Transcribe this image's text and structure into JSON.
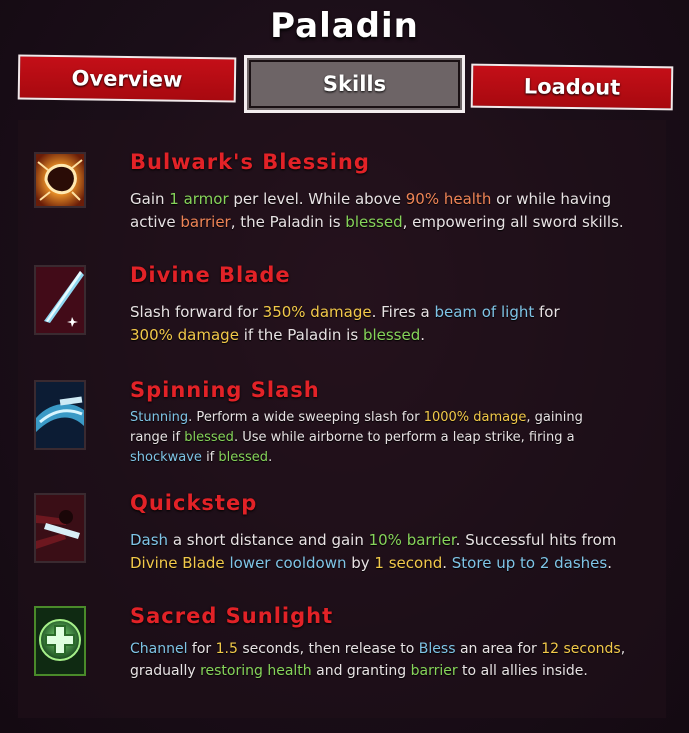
{
  "title": "Paladin",
  "tabs": {
    "overview": "Overview",
    "skills": "Skills",
    "loadout": "Loadout"
  },
  "colors": {
    "tab_red": "#c40f18",
    "skill_name": "#e22227",
    "green": "#86d35a",
    "orange": "#ee8456",
    "yellow": "#f2c94a",
    "blue": "#7fc4e6"
  },
  "skills": [
    {
      "name": "Bulwark's Blessing",
      "icon": "shield-crack-icon",
      "line1": [
        {
          "t": "Gain ",
          "c": ""
        },
        {
          "t": "1 armor",
          "c": "g"
        },
        {
          "t": " per level. While above ",
          "c": ""
        },
        {
          "t": "90% health",
          "c": "o"
        },
        {
          "t": " or while having",
          "c": ""
        }
      ],
      "line2": [
        {
          "t": "active ",
          "c": ""
        },
        {
          "t": "barrier",
          "c": "o"
        },
        {
          "t": ", the Paladin is ",
          "c": ""
        },
        {
          "t": "blessed",
          "c": "g"
        },
        {
          "t": ", empowering all sword skills.",
          "c": ""
        }
      ]
    },
    {
      "name": "Divine Blade",
      "icon": "sword-icon",
      "line1": [
        {
          "t": "Slash forward for ",
          "c": ""
        },
        {
          "t": "350% damage",
          "c": "y"
        },
        {
          "t": ". Fires a ",
          "c": ""
        },
        {
          "t": "beam of light",
          "c": "b"
        },
        {
          "t": " for",
          "c": ""
        }
      ],
      "line2": [
        {
          "t": "300% damage",
          "c": "y"
        },
        {
          "t": " if the Paladin is ",
          "c": ""
        },
        {
          "t": "blessed",
          "c": "g"
        },
        {
          "t": ".",
          "c": ""
        }
      ]
    },
    {
      "name": "Spinning Slash",
      "icon": "spin-slash-icon",
      "line1": [
        {
          "t": "Stunning",
          "c": "b"
        },
        {
          "t": ". Perform a wide sweeping slash for ",
          "c": ""
        },
        {
          "t": "1000% damage",
          "c": "y"
        },
        {
          "t": ", gaining",
          "c": ""
        }
      ],
      "line2": [
        {
          "t": "range if ",
          "c": ""
        },
        {
          "t": "blessed",
          "c": "g"
        },
        {
          "t": ". Use while airborne to perform a leap strike, firing a",
          "c": ""
        }
      ],
      "line3": [
        {
          "t": "shockwave",
          "c": "b"
        },
        {
          "t": " if ",
          "c": ""
        },
        {
          "t": "blessed",
          "c": "g"
        },
        {
          "t": ".",
          "c": ""
        }
      ]
    },
    {
      "name": "Quickstep",
      "icon": "dash-icon",
      "line1": [
        {
          "t": "Dash",
          "c": "b"
        },
        {
          "t": " a short distance and gain ",
          "c": ""
        },
        {
          "t": "10% barrier",
          "c": "g"
        },
        {
          "t": ". Successful hits from",
          "c": ""
        }
      ],
      "line2": [
        {
          "t": "Divine Blade",
          "c": "y"
        },
        {
          "t": " ",
          "c": ""
        },
        {
          "t": "lower cooldown",
          "c": "b"
        },
        {
          "t": " by ",
          "c": ""
        },
        {
          "t": "1 second",
          "c": "y"
        },
        {
          "t": ". ",
          "c": ""
        },
        {
          "t": "Store up to 2 dashes",
          "c": "b"
        },
        {
          "t": ".",
          "c": ""
        }
      ]
    },
    {
      "name": "Sacred Sunlight",
      "icon": "holy-cross-icon",
      "line1": [
        {
          "t": "Channel",
          "c": "b"
        },
        {
          "t": " for ",
          "c": ""
        },
        {
          "t": "1.5",
          "c": "y"
        },
        {
          "t": " seconds, then release to ",
          "c": ""
        },
        {
          "t": "Bless",
          "c": "b"
        },
        {
          "t": " an area for ",
          "c": ""
        },
        {
          "t": "12 seconds",
          "c": "y"
        },
        {
          "t": ",",
          "c": ""
        }
      ],
      "line2": [
        {
          "t": "gradually ",
          "c": ""
        },
        {
          "t": "restoring health",
          "c": "g"
        },
        {
          "t": " and granting ",
          "c": ""
        },
        {
          "t": "barrier",
          "c": "g"
        },
        {
          "t": " to all allies inside.",
          "c": ""
        }
      ]
    }
  ]
}
